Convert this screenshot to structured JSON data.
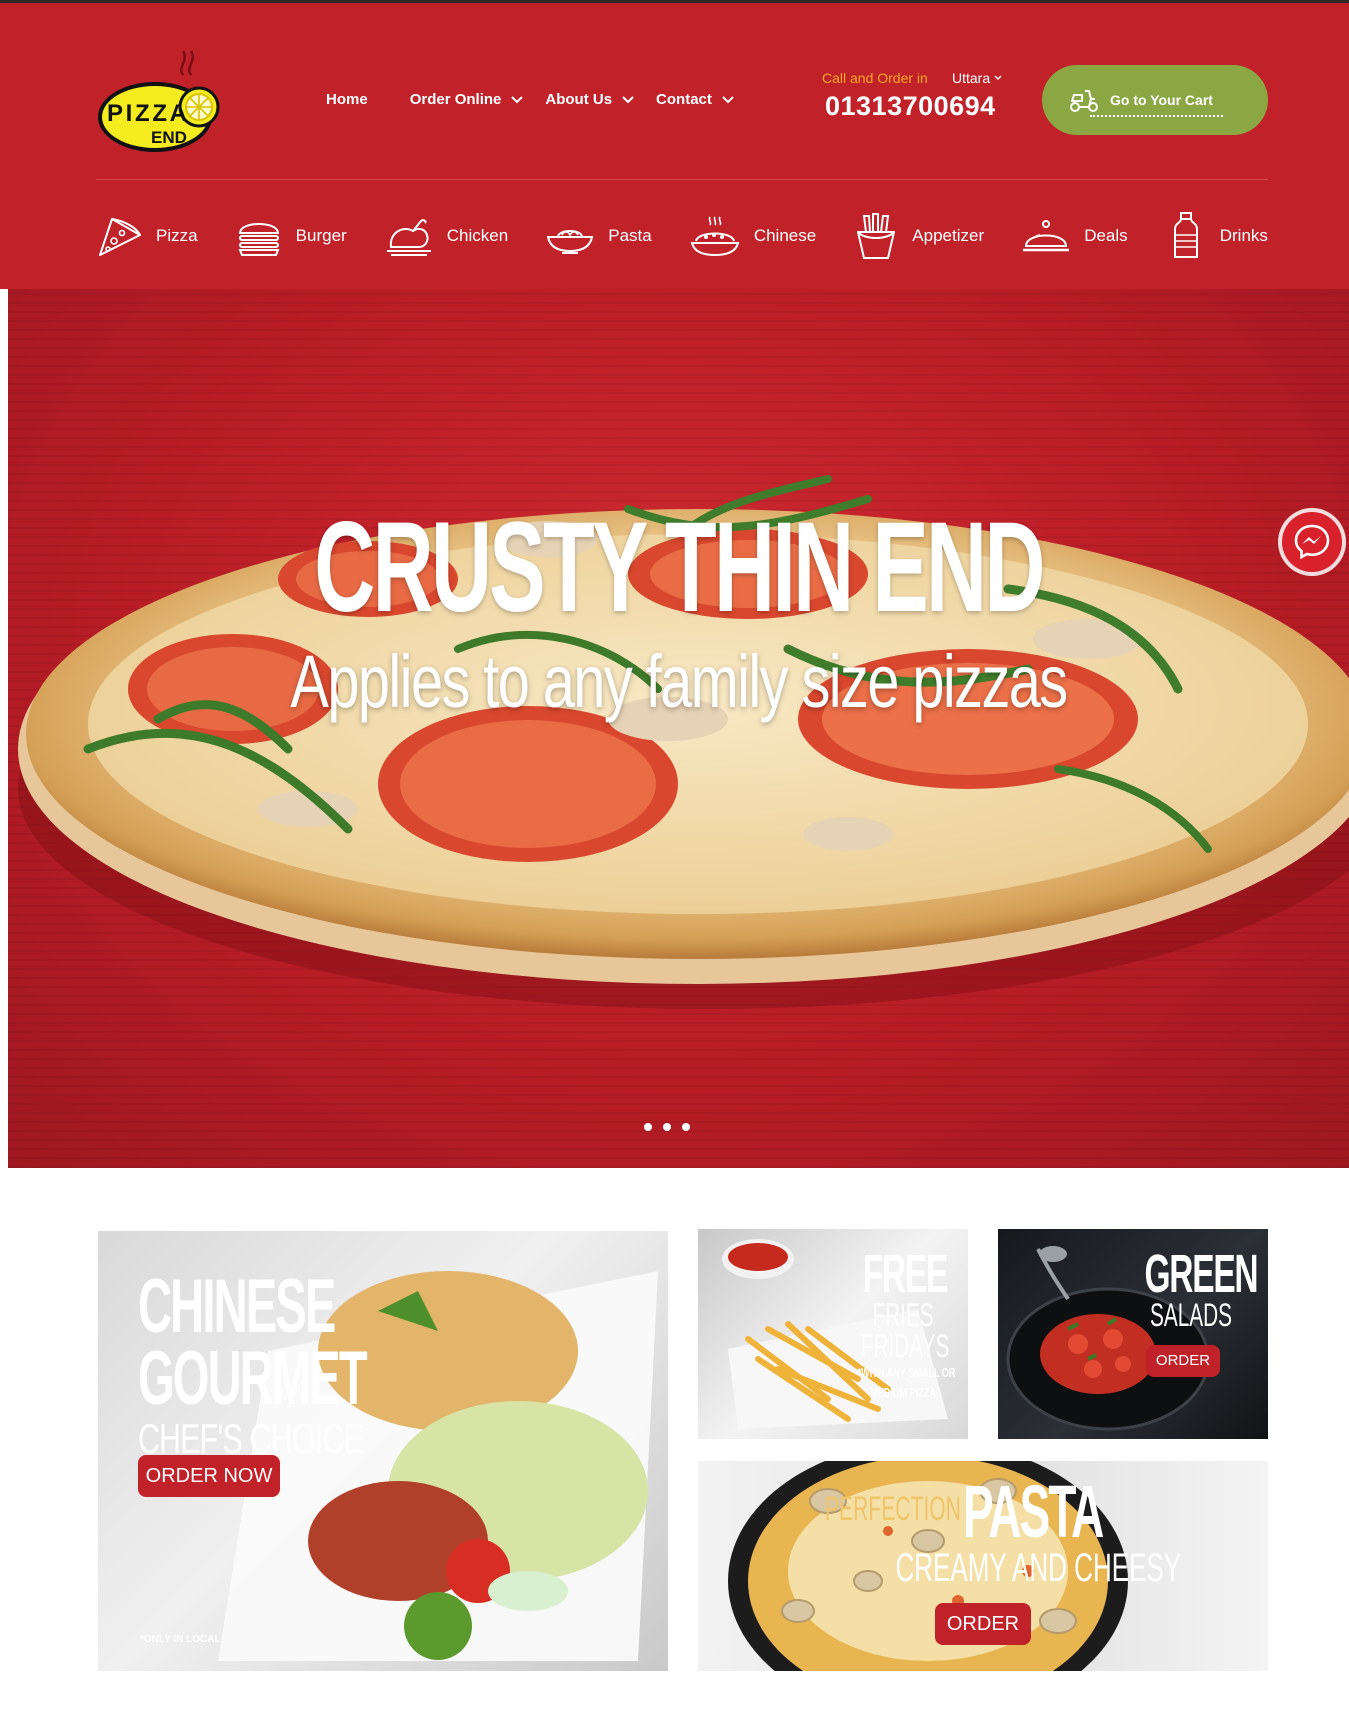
{
  "brand": {
    "logo_text_top": "PIZZA",
    "logo_text_bottom": "END",
    "red": "#c1222a",
    "green": "#8ba743",
    "orange": "#f5a623"
  },
  "nav": {
    "items": [
      {
        "label": "Home",
        "dropdown": false
      },
      {
        "label": "Order Online",
        "dropdown": true
      },
      {
        "label": "About Us",
        "dropdown": true
      },
      {
        "label": "Contact",
        "dropdown": true
      }
    ]
  },
  "order_info": {
    "call_label": "Call and Order in",
    "branch": "Uttara",
    "phone": "01313700694"
  },
  "cart": {
    "label": "Go to Your Cart",
    "icon": "scooter-icon"
  },
  "categories": [
    {
      "label": "Pizza",
      "icon": "pizza-slice-icon"
    },
    {
      "label": "Burger",
      "icon": "burger-icon"
    },
    {
      "label": "Chicken",
      "icon": "chicken-icon"
    },
    {
      "label": "Pasta",
      "icon": "pasta-bowl-icon"
    },
    {
      "label": "Chinese",
      "icon": "chinese-dish-icon"
    },
    {
      "label": "Appetizer",
      "icon": "fries-icon"
    },
    {
      "label": "Deals",
      "icon": "cloche-icon"
    },
    {
      "label": "Drinks",
      "icon": "bottle-icon"
    }
  ],
  "hero": {
    "title": "CRUSTY THIN END",
    "subtitle": "Applies to any family size pizzas",
    "slides": 3
  },
  "promos": {
    "chinese": {
      "line1": "CHINESE",
      "line2": "GOURMET",
      "line3": "CHEF'S CHOICE",
      "button": "ORDER NOW",
      "note": "*ONLY IN LOCAL"
    },
    "fries": {
      "line1": "FREE",
      "line2": "FRIES",
      "line3": "FRIDAYS",
      "note1": "*WITH ANY SMALL OR",
      "note2": "MEDIUM PIZZA"
    },
    "salad": {
      "line1": "GREEN",
      "line2": "SALADS",
      "button": "ORDER"
    },
    "pasta": {
      "line1": "PERFECTION",
      "line2": "PASTA",
      "line3": "CREAMY AND CHEESY",
      "button": "ORDER"
    }
  }
}
